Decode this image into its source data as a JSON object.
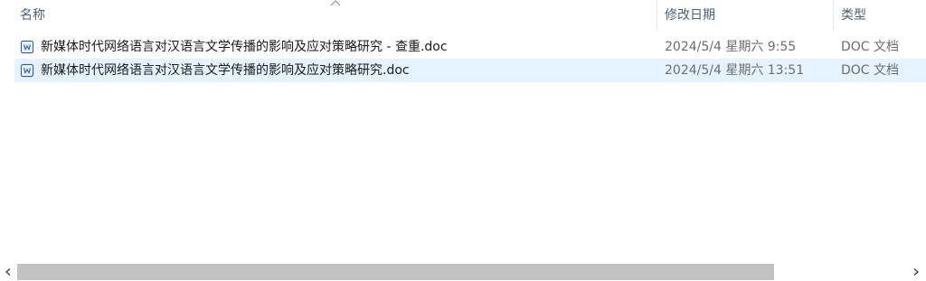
{
  "header": {
    "columns": [
      {
        "label": "名称",
        "sorted": "ascending"
      },
      {
        "label": "修改日期"
      },
      {
        "label": "类型"
      }
    ]
  },
  "files": [
    {
      "name": "新媒体时代网络语言对汉语言文学传播的影响及应对策略研究 - 查重.doc",
      "modified": "2024/5/4 星期六 9:55",
      "type": "DOC 文档",
      "icon": "word-doc-icon",
      "selected": false
    },
    {
      "name": "新媒体时代网络语言对汉语言文学传播的影响及应对策略研究.doc",
      "modified": "2024/5/4 星期六 13:51",
      "type": "DOC 文档",
      "icon": "word-doc-icon",
      "selected": true
    }
  ],
  "scrollbar": {
    "thumb_fraction": 0.85
  },
  "colors": {
    "selection": "#e5f3ff",
    "header_text": "#4c607a",
    "icon_blue": "#2b5fb8"
  }
}
